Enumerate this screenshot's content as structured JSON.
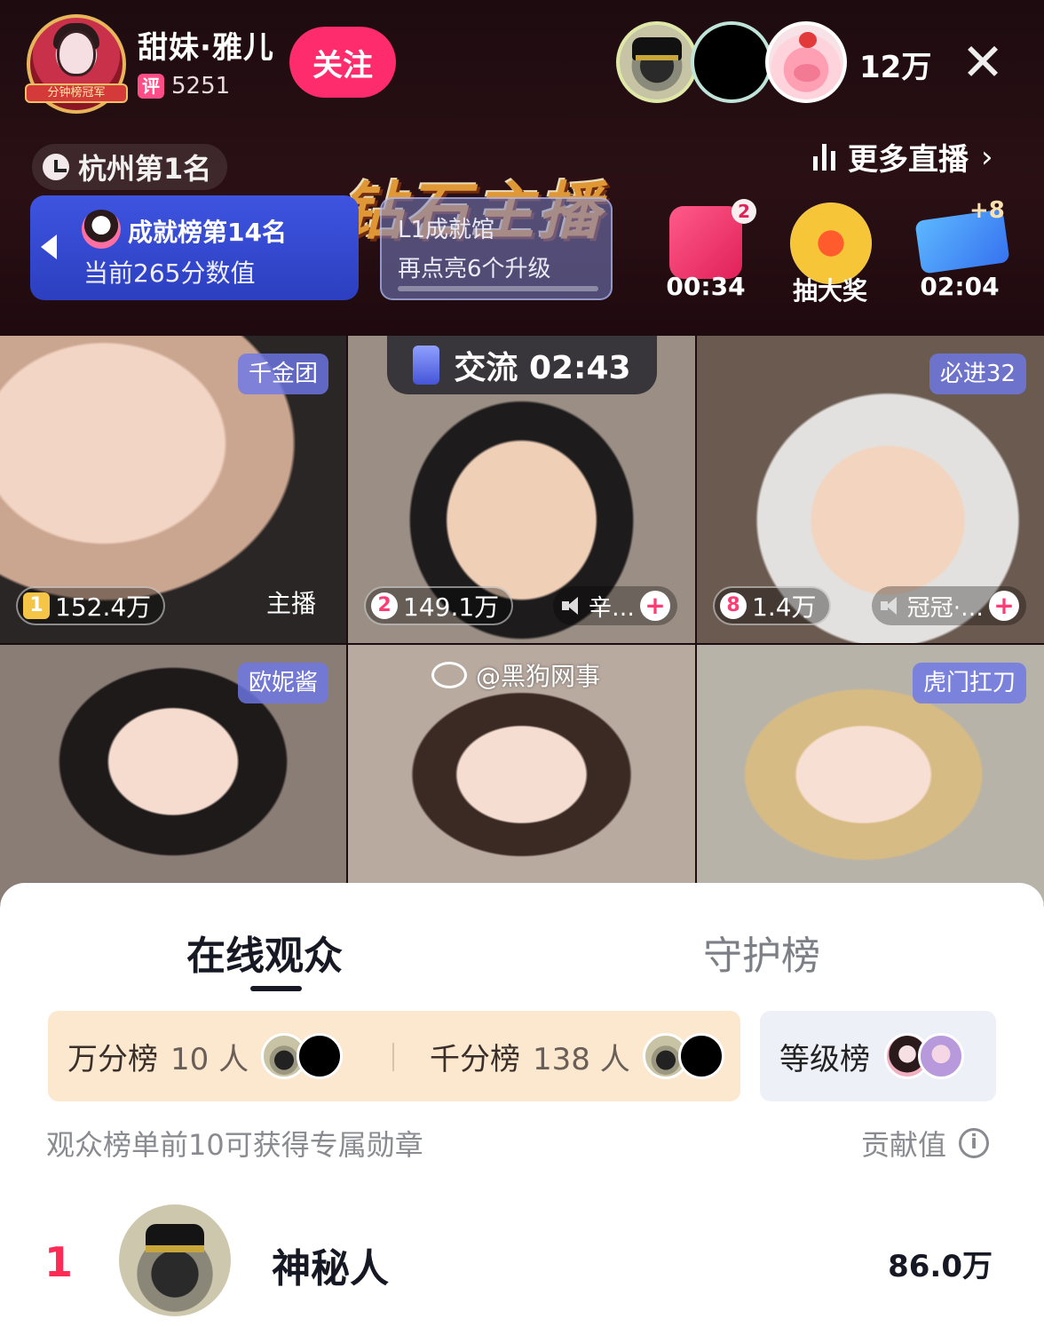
{
  "header": {
    "host_name": "甜妹·雅儿",
    "host_badge": "分钟榜冠军",
    "rating_icon": "评",
    "rating_score": "5251",
    "follow_label": "关注",
    "viewer_count": "12万",
    "close_icon": "✕",
    "city_rank": "杭州第1名",
    "more_live_label": "更多直播",
    "more_live_chevron": "›"
  },
  "achievement": {
    "title": "成就榜第14名",
    "subtitle": "当前265分数值"
  },
  "banner": {
    "text": "钻石主播"
  },
  "hall": {
    "title": "L1成就馆",
    "subtitle": "再点亮6个升级"
  },
  "activities": [
    {
      "label": "00:34",
      "badge": "2",
      "icon": "host-gift-icon"
    },
    {
      "label": "抽大奖",
      "icon": "lottery-wheel-icon"
    },
    {
      "label": "02:04",
      "badge": "+8",
      "icon": "popularity-ticket-icon"
    }
  ],
  "grid": {
    "exchange_label": "交流 02:43",
    "tiles": [
      {
        "tag": "千金团",
        "rank": "1",
        "score": "152.4万",
        "role": "主播"
      },
      {
        "rank": "2",
        "score": "149.1万",
        "guest": "辛…",
        "plus": "+"
      },
      {
        "tag": "必进32",
        "rank": "8",
        "score": "1.4万",
        "guest": "冠冠·…",
        "plus": "+"
      },
      {
        "tag": "欧妮酱"
      },
      {},
      {
        "tag": "虎门扛刀"
      }
    ],
    "watermark": "@黑狗网事"
  },
  "sheet": {
    "tabs": [
      {
        "label": "在线观众",
        "active": true
      },
      {
        "label": "守护榜",
        "active": false
      }
    ],
    "boards": [
      {
        "label": "万分榜",
        "count": "10 人"
      },
      {
        "label": "千分榜",
        "count": "138 人"
      }
    ],
    "level_board": "等级榜",
    "hint": "观众榜单前10可获得专属勋章",
    "contrib_label": "贡献值",
    "info_icon": "i",
    "rows": [
      {
        "rank": "1",
        "name": "神秘人",
        "value": "86.0万"
      }
    ]
  },
  "colors": {
    "accent": "#fe2c6c",
    "rank_red": "#fe2c55",
    "tag_blue": "#6e78e6"
  }
}
